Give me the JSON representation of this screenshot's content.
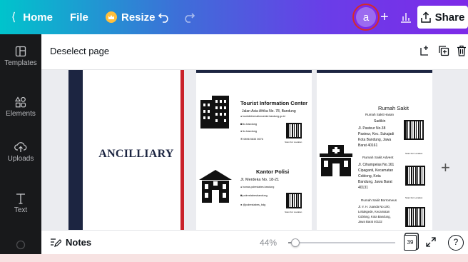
{
  "topbar": {
    "home_label": "Home",
    "file_label": "File",
    "resize_label": "Resize",
    "avatar_letter": "a",
    "share_label": "Share",
    "gradient_start": "#00c4cc",
    "gradient_end": "#7d2ae8"
  },
  "sidebar": {
    "items": [
      {
        "label": "Templates",
        "icon": "templates-icon"
      },
      {
        "label": "Elements",
        "icon": "elements-icon"
      },
      {
        "label": "Uploads",
        "icon": "uploads-icon"
      },
      {
        "label": "Text",
        "icon": "text-icon"
      }
    ]
  },
  "context": {
    "deselect_label": "Deselect page"
  },
  "pages": {
    "page1": {
      "title": "ANCILLIARY"
    },
    "page2": {
      "tic_title": "Tourist Information Center",
      "tic_addr": "Jalan Asia Afrika No. 78, Bandung",
      "tic_web": "touristinformationcenter.bandung.go.id",
      "tic_ig": "tic.bandung",
      "tic_tw": "tic.bandung",
      "tic_phone": "0896 5633 0676",
      "qr_caption": "Scan For Location",
      "kp_title": "Kantor Polisi",
      "kp_addr": "Jl. Merdeka No. 18-21",
      "kp_web": "humas.polrestabes.bandung",
      "kp_ig": "polrestabesbandung",
      "kp_tw": "@polrestabes_bdg"
    },
    "page3": {
      "rs_title": "Rumah Sakit",
      "rs1_name": "Rumah Sakit Hasan",
      "rs1_name2": "Sadikin",
      "rs1_addr1": "Jl.     Pasteur     No.38",
      "rs1_addr2": "Pasteur, Kec. Sukajadi",
      "rs1_addr3": "Kota   Bandung,  Jawa",
      "rs1_addr4": "Barat 40161",
      "rs2_name": "Rumah Sakit Advent",
      "rs2_addr1": "Jl. Cihampelas No.161",
      "rs2_addr2": "Cipaganti,  Kecamatan",
      "rs2_addr3": "Coblong,          Kota",
      "rs2_addr4": "Bandung,  Jawa  Barat",
      "rs2_addr5": "40131",
      "rs3_name": "Rumah Sakit Borromeus",
      "rs3_addr1": "Jl. Ir. H. Juanda No.100,",
      "rs3_addr2": "Lebakgede,       Kecamatan",
      "rs3_addr3": "Coblong,  Kota  Bandung,",
      "rs3_addr4": "Jawa Barat 40132",
      "qr_caption": "Scan For Location"
    }
  },
  "bottombar": {
    "notes_label": "Notes",
    "zoom_label": "44%",
    "zoom_level": 0.44,
    "page_count": "39",
    "help_label": "?"
  }
}
